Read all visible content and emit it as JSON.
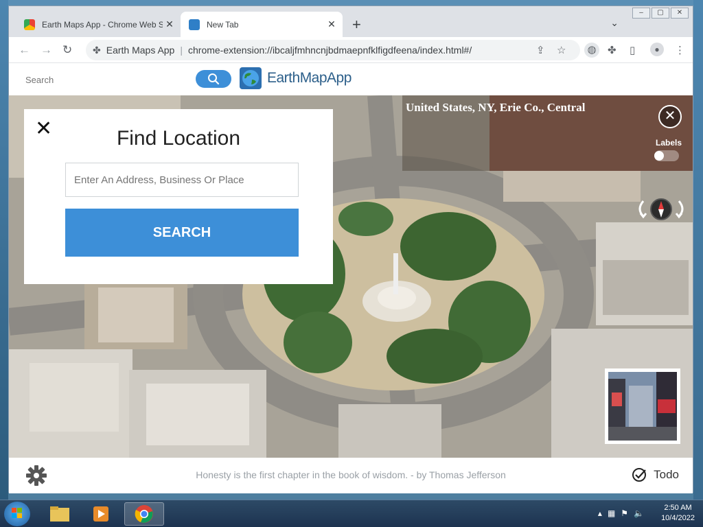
{
  "browser": {
    "tabs": [
      {
        "label": "Earth Maps App - Chrome Web Store",
        "active": false
      },
      {
        "label": "New Tab",
        "active": true
      }
    ],
    "address": {
      "extension_name": "Earth Maps App",
      "url": "chrome-extension://ibcaljfmhncnjbdmaepnfklfigdfeena/index.html#/"
    }
  },
  "app": {
    "search_placeholder": "Search",
    "brand": "EarthMapApp",
    "panel": {
      "title": "Find Location",
      "address_placeholder": "Enter An Address, Business Or Place",
      "search_button": "SEARCH"
    },
    "location_label": "United States, NY, Erie Co., Central",
    "labels_toggle": "Labels",
    "quote": "Honesty is the first chapter in the book of wisdom. - by Thomas Jefferson",
    "todo_label": "Todo"
  },
  "taskbar": {
    "time": "2:50 AM",
    "date": "10/4/2022"
  },
  "colors": {
    "accent": "#3d8fd8",
    "brand_text": "#2c5f8a"
  }
}
